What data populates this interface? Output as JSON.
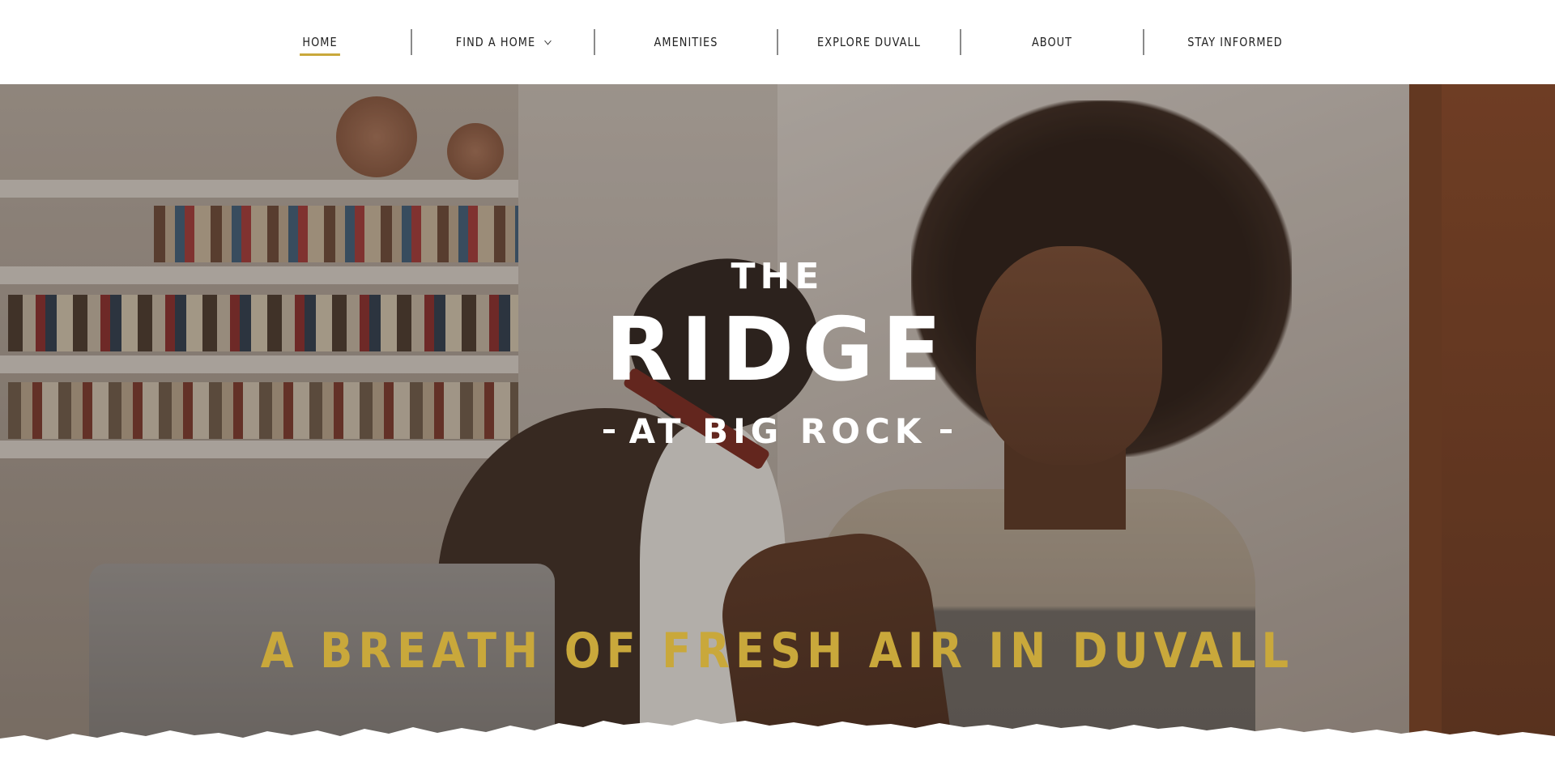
{
  "nav": {
    "items": [
      {
        "label": "HOME",
        "active": true
      },
      {
        "label": "FIND A HOME",
        "has_dropdown": true
      },
      {
        "label": "AMENITIES"
      },
      {
        "label": "EXPLORE DUVALL"
      },
      {
        "label": "ABOUT"
      },
      {
        "label": "STAY INFORMED"
      }
    ],
    "active_underline_color": "#c9a83b"
  },
  "hero": {
    "title_top": "THE",
    "title_main": "RIDGE",
    "title_sub": "AT BIG ROCK",
    "tagline": "A BREATH OF FRESH AIR IN DUVALL",
    "tagline_color": "#c9a83b",
    "image_description_icon": "hero-photo"
  }
}
